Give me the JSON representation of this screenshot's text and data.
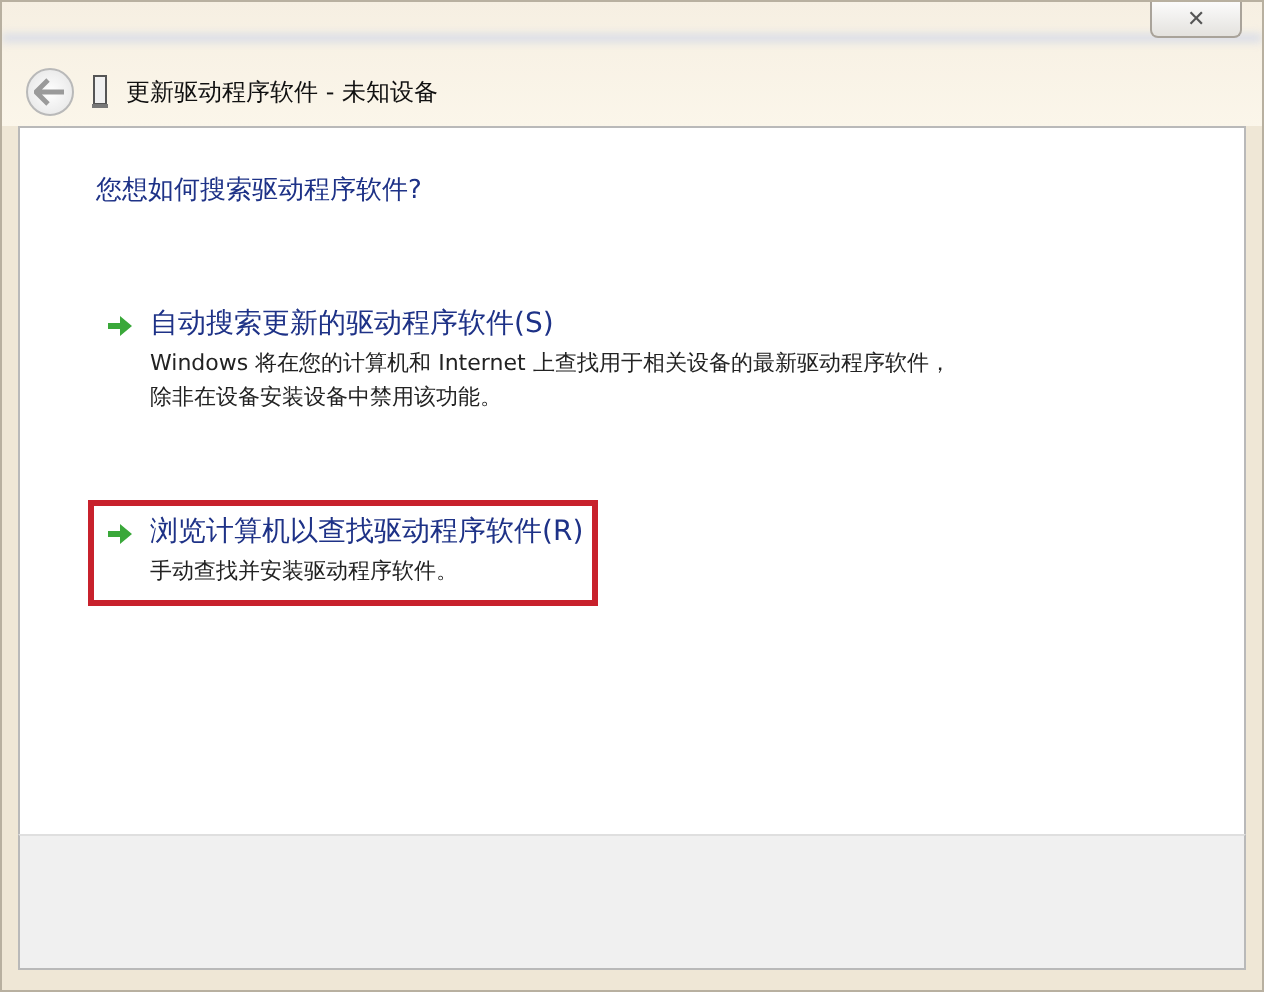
{
  "window": {
    "title": "更新驱动程序软件 - 未知设备",
    "close": "✕"
  },
  "heading": "您想如何搜索驱动程序软件?",
  "options": [
    {
      "title": "自动搜索更新的驱动程序软件(S)",
      "description": "Windows 将在您的计算机和 Internet 上查找用于相关设备的最新驱动程序软件，除非在设备安装设备中禁用该功能。",
      "selected": false
    },
    {
      "title": "浏览计算机以查找驱动程序软件(R)",
      "description": "手动查找并安装驱动程序软件。",
      "selected": true
    }
  ]
}
